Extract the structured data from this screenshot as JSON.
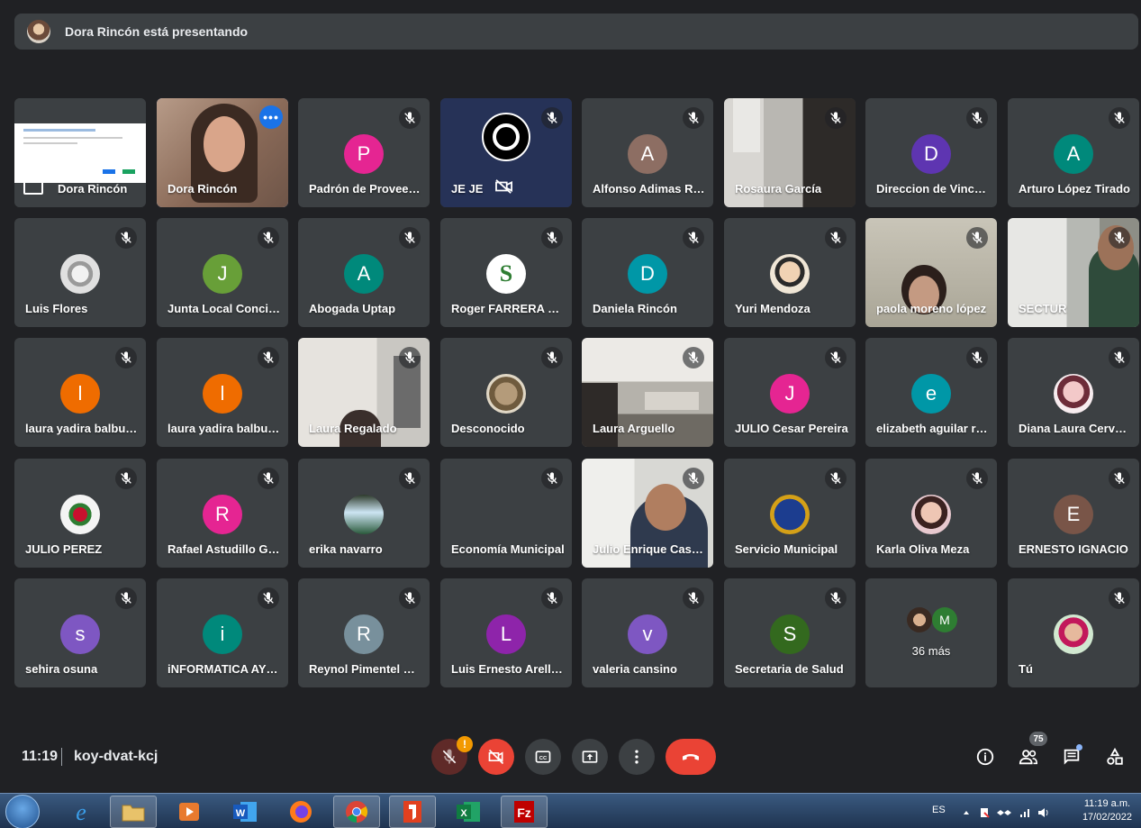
{
  "banner": {
    "text": "Dora Rincón está presentando"
  },
  "tiles": [
    {
      "name": "Dora Rincón",
      "type": "screen"
    },
    {
      "name": "Dora Rincón",
      "type": "video-dora"
    },
    {
      "name": "Padrón de Proveedores",
      "type": "avatar",
      "letter": "P",
      "color": "#e52592"
    },
    {
      "name": "JE JE",
      "type": "obs"
    },
    {
      "name": "Alfonso Adimas Ramírez",
      "type": "avatar",
      "letter": "A",
      "color": "#8d6e63"
    },
    {
      "name": "Rosaura García",
      "type": "video-room"
    },
    {
      "name": "Direccion de Vinculación",
      "type": "avatar",
      "letter": "D",
      "color": "#5e35b1"
    },
    {
      "name": "Arturo López Tirado",
      "type": "avatar",
      "letter": "A",
      "color": "#00897b"
    },
    {
      "name": "Luis Flores",
      "type": "img",
      "img": "tiger"
    },
    {
      "name": "Junta Local Conciliación",
      "type": "avatar",
      "letter": "J",
      "color": "#689f38"
    },
    {
      "name": "Abogada Uptap",
      "type": "avatar",
      "letter": "A",
      "color": "#00897b"
    },
    {
      "name": "Roger FARRERA Hernández",
      "type": "img",
      "img": "s-logo"
    },
    {
      "name": "Daniela Rincón",
      "type": "avatar",
      "letter": "D",
      "color": "#0097a7"
    },
    {
      "name": "Yuri Mendoza",
      "type": "img",
      "img": "portrait"
    },
    {
      "name": "paola moreno lópez",
      "type": "video-paola"
    },
    {
      "name": "SECTUR",
      "type": "video-sectur"
    },
    {
      "name": "laura yadira balbuena",
      "type": "avatar",
      "letter": "l",
      "color": "#ef6c00"
    },
    {
      "name": "laura yadira balbuena",
      "type": "avatar",
      "letter": "l",
      "color": "#ef6c00"
    },
    {
      "name": "Laura Regalado",
      "type": "video-office"
    },
    {
      "name": "Desconocido",
      "type": "img",
      "img": "mask"
    },
    {
      "name": "Laura Arguello",
      "type": "video-office2"
    },
    {
      "name": "JULIO Cesar Pereira",
      "type": "avatar",
      "letter": "J",
      "color": "#e52592"
    },
    {
      "name": "elizabeth aguilar reyes",
      "type": "avatar",
      "letter": "e",
      "color": "#0097a7"
    },
    {
      "name": "Diana Laura Cervantes",
      "type": "img",
      "img": "girl"
    },
    {
      "name": "JULIO PEREZ",
      "type": "img",
      "img": "shield"
    },
    {
      "name": "Rafael Astudillo Gómez",
      "type": "avatar",
      "letter": "R",
      "color": "#e52592"
    },
    {
      "name": "erika navarro",
      "type": "img",
      "img": "waterfall"
    },
    {
      "name": "Economía Municipal",
      "type": "blank"
    },
    {
      "name": "Julio Enrique Castro",
      "type": "video-julio"
    },
    {
      "name": "Servicio Municipal",
      "type": "img",
      "img": "logo-blue"
    },
    {
      "name": "Karla Oliva Meza",
      "type": "img",
      "img": "karla"
    },
    {
      "name": "ERNESTO IGNACIO",
      "type": "avatar",
      "letter": "E",
      "color": "#795548"
    },
    {
      "name": "sehira osuna",
      "type": "avatar",
      "letter": "s",
      "color": "#7e57c2"
    },
    {
      "name": "iNFORMATICA AYUNTAMIENTO",
      "type": "avatar",
      "letter": "i",
      "color": "#00897b"
    },
    {
      "name": "Reynol Pimentel Soto",
      "type": "avatar",
      "letter": "R",
      "color": "#78909c"
    },
    {
      "name": "Luis Ernesto Arellano",
      "type": "avatar",
      "letter": "L",
      "color": "#8e24aa"
    },
    {
      "name": "valeria cansino",
      "type": "avatar",
      "letter": "v",
      "color": "#7e57c2"
    },
    {
      "name": "Secretaria de Salud",
      "type": "avatar",
      "letter": "S",
      "color": "#33691e"
    },
    {
      "name": "36 más",
      "type": "more",
      "letter": "M"
    },
    {
      "name": "Tú",
      "type": "img",
      "img": "you"
    }
  ],
  "controls": {
    "time": "11:19",
    "meeting_code": "koy-dvat-kcj",
    "warning": "!",
    "participants_count": "75"
  },
  "taskbar": {
    "lang": "ES",
    "clock_time": "11:19 a.m.",
    "clock_date": "17/02/2022"
  },
  "colors": {
    "accent": "#8ab4f8",
    "end_call": "#ea4335",
    "tile_bg": "#3c4043",
    "page_bg": "#202124"
  }
}
